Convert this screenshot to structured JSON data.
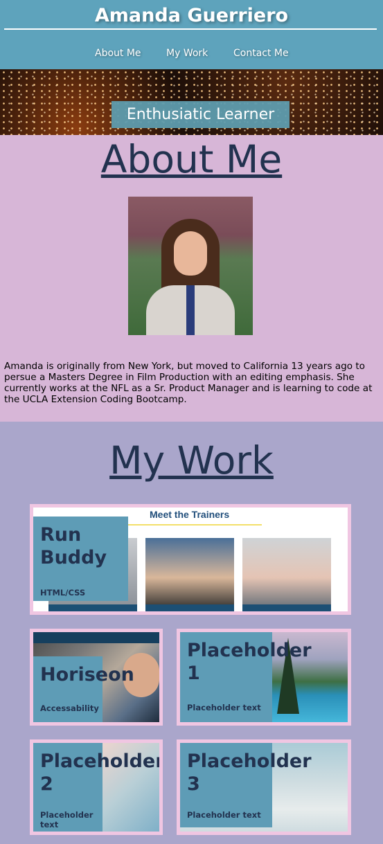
{
  "header": {
    "title": "Amanda Guerriero",
    "nav": [
      "About Me",
      "My Work",
      "Contact Me"
    ]
  },
  "hero": {
    "label": "Enthusiatic Learner"
  },
  "about": {
    "heading": "About Me",
    "text": "Amanda is originally from New York, but moved to California 13 years ago to persue a Masters Degree in Film Production with an editing emphasis. She currently works at the NFL as a Sr. Product Manager and is learning to code at the UCLA Extension Coding Bootcamp."
  },
  "work": {
    "heading": "My Work",
    "projects": [
      {
        "title_lines": [
          "Run",
          "Buddy"
        ],
        "subtitle": "HTML/CSS",
        "image_heading": "Meet the Trainers"
      },
      {
        "title_lines": [
          "Horiseon"
        ],
        "subtitle": "Accessability"
      },
      {
        "title_lines": [
          "Placeholder",
          "1"
        ],
        "subtitle": "Placeholder text"
      },
      {
        "title_lines": [
          "Placeholder",
          "2"
        ],
        "subtitle": "Placeholder text"
      },
      {
        "title_lines": [
          "Placeholder",
          "3"
        ],
        "subtitle": "Placeholder text"
      }
    ]
  },
  "colors": {
    "header": "#5ea3bc",
    "about_bg": "#d7b6d7",
    "work_bg": "#aaa6cb",
    "heading_text": "#22324f",
    "card_label": "#5e9cb6",
    "card_border": "#f0c6e2"
  }
}
